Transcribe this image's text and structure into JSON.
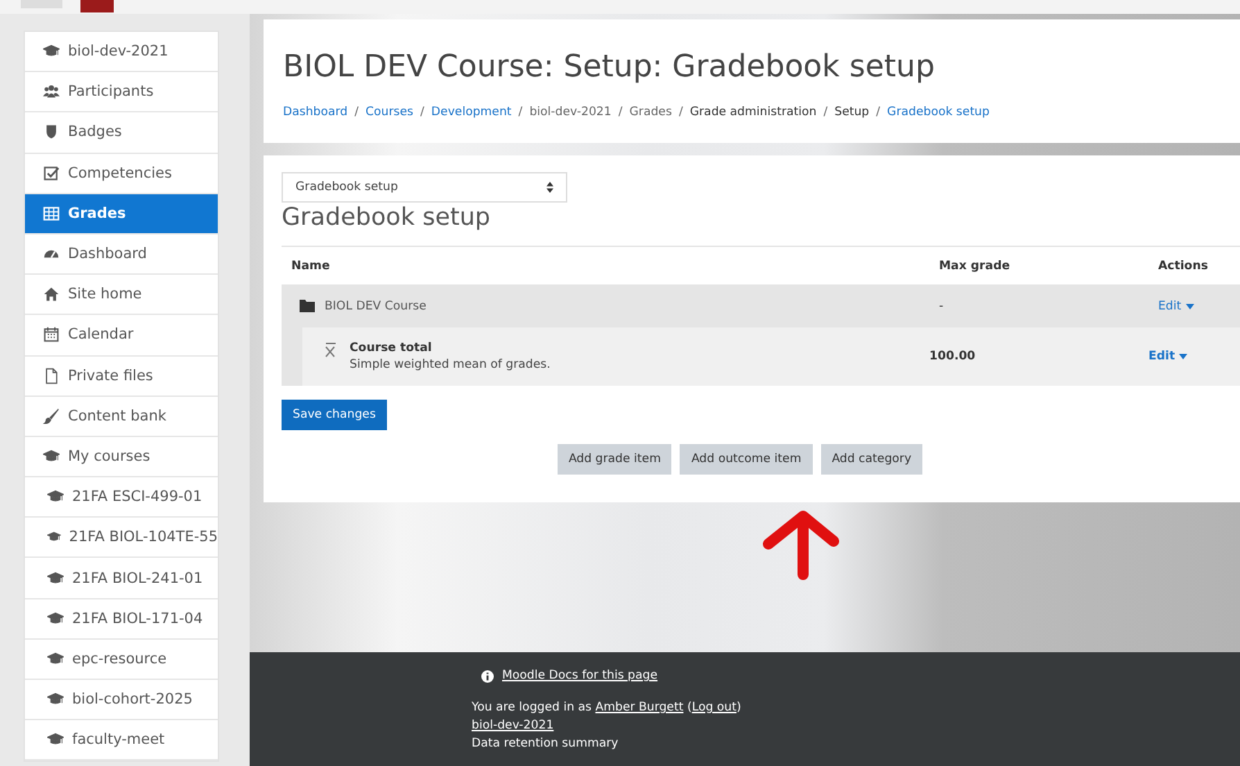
{
  "sidebar": {
    "items": [
      {
        "label": "biol-dev-2021",
        "selected": false
      },
      {
        "label": "Participants",
        "selected": false
      },
      {
        "label": "Badges",
        "selected": false
      },
      {
        "label": "Competencies",
        "selected": false
      },
      {
        "label": "Grades",
        "selected": true
      },
      {
        "label": "Dashboard",
        "selected": false
      },
      {
        "label": "Site home",
        "selected": false
      },
      {
        "label": "Calendar",
        "selected": false
      },
      {
        "label": "Private files",
        "selected": false
      },
      {
        "label": "Content bank",
        "selected": false
      },
      {
        "label": "My courses",
        "selected": false
      },
      {
        "label": "21FA ESCI-499-01",
        "selected": false
      },
      {
        "label": "21FA BIOL-104TE-55",
        "selected": false
      },
      {
        "label": "21FA BIOL-241-01",
        "selected": false
      },
      {
        "label": "21FA BIOL-171-04",
        "selected": false
      },
      {
        "label": "epc-resource",
        "selected": false
      },
      {
        "label": "biol-cohort-2025",
        "selected": false
      },
      {
        "label": "faculty-meet",
        "selected": false
      }
    ]
  },
  "header": {
    "title": "BIOL DEV Course: Setup: Gradebook setup",
    "breadcrumb": [
      {
        "kind": "link",
        "label": "Dashboard"
      },
      {
        "kind": "separator",
        "label": "/"
      },
      {
        "kind": "link",
        "label": "Courses"
      },
      {
        "kind": "separator",
        "label": "/"
      },
      {
        "kind": "link",
        "label": "Development"
      },
      {
        "kind": "separator",
        "label": "/"
      },
      {
        "kind": "text",
        "label": "biol-dev-2021"
      },
      {
        "kind": "separator",
        "label": "/"
      },
      {
        "kind": "text",
        "label": "Grades"
      },
      {
        "kind": "separator",
        "label": "/"
      },
      {
        "kind": "text",
        "label": "Grade administration"
      },
      {
        "kind": "separator",
        "label": "/"
      },
      {
        "kind": "text",
        "label": "Setup"
      },
      {
        "kind": "separator",
        "label": "/"
      },
      {
        "kind": "link",
        "label": "Gradebook setup"
      }
    ]
  },
  "gradebook": {
    "select": "Gradebook setup",
    "heading": "Gradebook setup",
    "columns": [
      "Name",
      "Max grade",
      "Actions"
    ],
    "rows": [
      {
        "kind": "category",
        "name": "BIOL DEV Course",
        "max_grade": "-",
        "action": "Edit"
      },
      {
        "kind": "total",
        "name": "Course total",
        "description": "Simple weighted mean of grades.",
        "max_grade": "100.00",
        "action": "Edit"
      }
    ],
    "save_button": "Save changes",
    "buttons": [
      "Add grade item",
      "Add outcome item",
      "Add category"
    ]
  },
  "footer": {
    "docs_link": "Moodle Docs for this page",
    "login_prefix": "You are logged in as",
    "user": "Amber Burgett",
    "paren_open": "(",
    "logout": "Log out",
    "paren_close": ")",
    "course_link": "biol-dev-2021",
    "data_retention": "Data retention summary"
  }
}
